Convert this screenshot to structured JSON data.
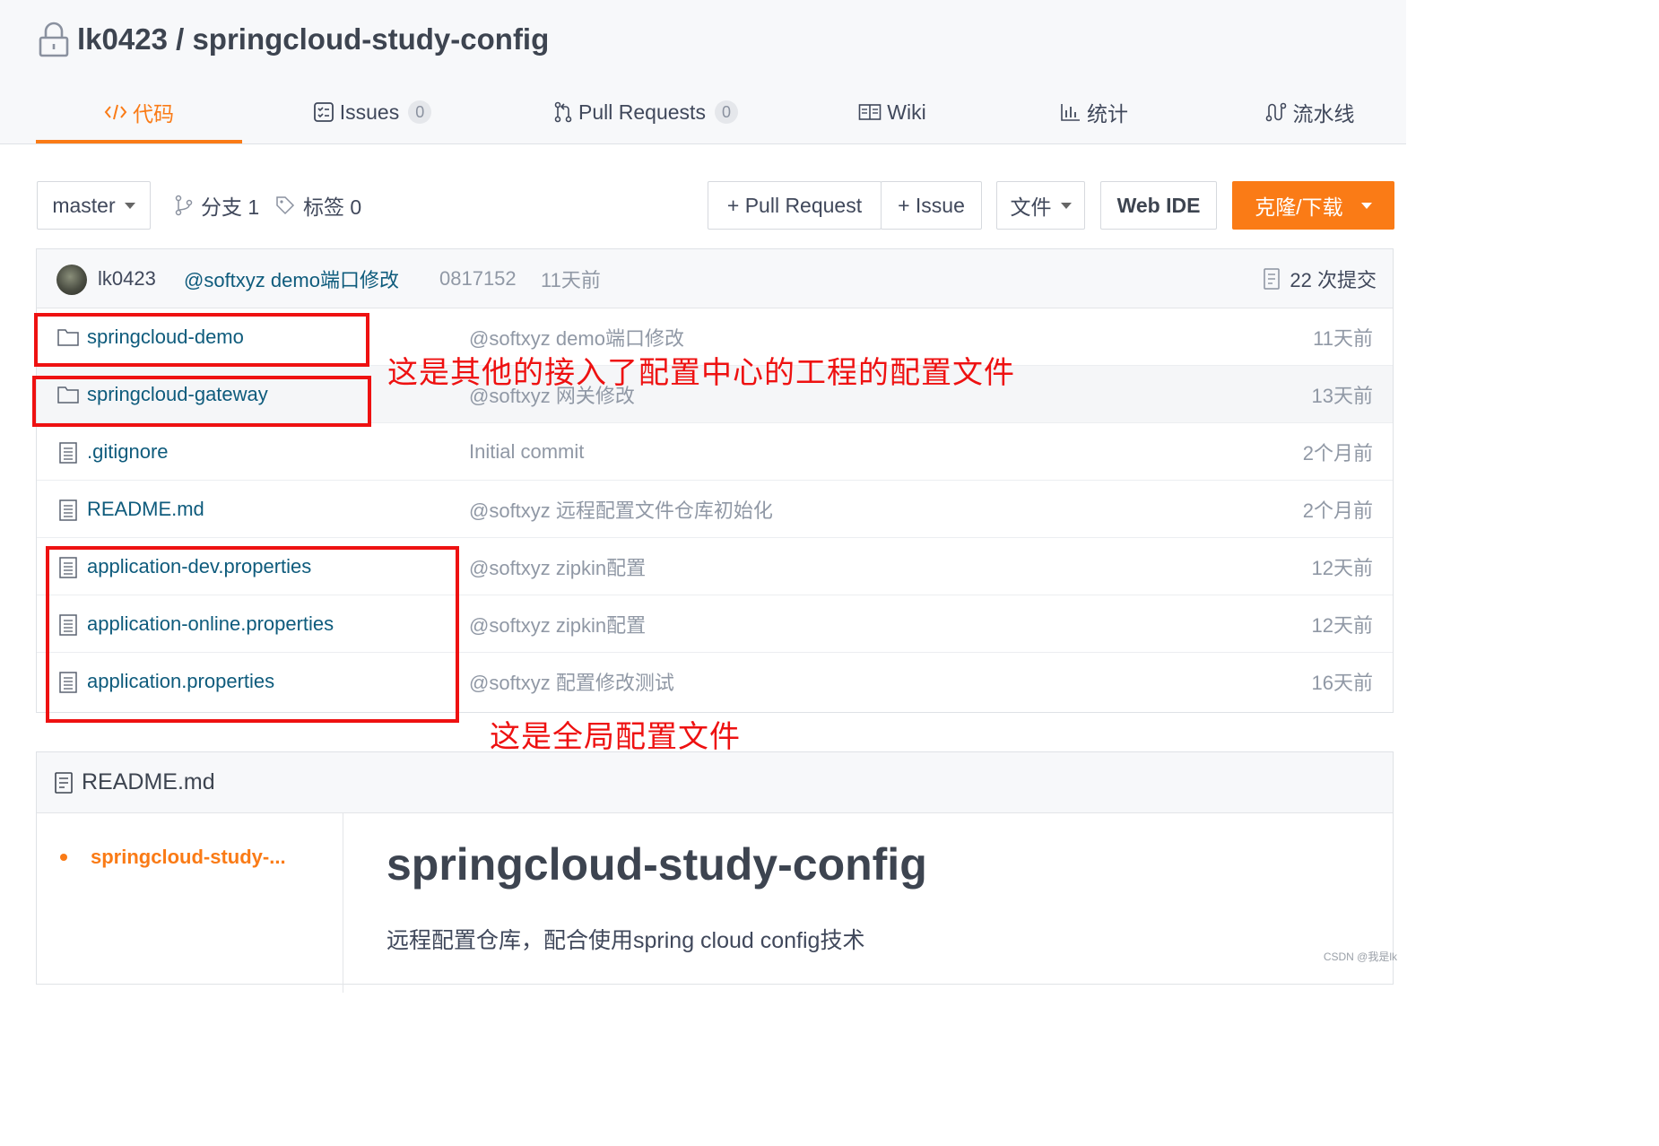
{
  "repo": {
    "owner": "lk0423",
    "separator": " / ",
    "name": "springcloud-study-config"
  },
  "tabs": [
    {
      "label": "代码",
      "icon": "code-icon"
    },
    {
      "label": "Issues",
      "icon": "issues-icon",
      "count": "0"
    },
    {
      "label": "Pull Requests",
      "icon": "pull-request-icon",
      "count": "0"
    },
    {
      "label": "Wiki",
      "icon": "wiki-icon"
    },
    {
      "label": "统计",
      "icon": "chart-icon"
    },
    {
      "label": "流水线",
      "icon": "pipeline-icon"
    }
  ],
  "toolbar": {
    "branch": "master",
    "branches": "分支 1",
    "tags": "标签 0",
    "pull_request": "+ Pull Request",
    "issue": "+ Issue",
    "file": "文件",
    "web_ide": "Web IDE",
    "clone": "克隆/下载"
  },
  "commit": {
    "author": "lk0423",
    "message": "@softxyz demo端口修改",
    "sha": "0817152",
    "time": "11天前",
    "count": "22 次提交"
  },
  "files": [
    {
      "type": "folder",
      "name": "springcloud-demo",
      "message": "@softxyz demo端口修改",
      "time": "11天前"
    },
    {
      "type": "folder",
      "name": "springcloud-gateway",
      "message": "@softxyz 网关修改",
      "time": "13天前"
    },
    {
      "type": "file",
      "name": ".gitignore",
      "message": "Initial commit",
      "time": "2个月前"
    },
    {
      "type": "file",
      "name": "README.md",
      "message": "@softxyz 远程配置文件仓库初始化",
      "time": "2个月前"
    },
    {
      "type": "file",
      "name": "application-dev.properties",
      "message": "@softxyz zipkin配置",
      "time": "12天前"
    },
    {
      "type": "file",
      "name": "application-online.properties",
      "message": "@softxyz zipkin配置",
      "time": "12天前"
    },
    {
      "type": "file",
      "name": "application.properties",
      "message": "@softxyz 配置修改测试",
      "time": "16天前"
    }
  ],
  "annotations": {
    "projects": "这是其他的接入了配置中心的工程的配置文件",
    "global": "这是全局配置文件"
  },
  "readme": {
    "filename": "README.md",
    "toc_item": "springcloud-study-...",
    "heading": "springcloud-study-config",
    "description": "远程配置仓库，配合使用spring cloud config技术"
  },
  "watermark": "CSDN @我是lk",
  "colors": {
    "accent": "#fa7b16",
    "link": "#0e5b7c",
    "annotation": "#ee1111"
  }
}
